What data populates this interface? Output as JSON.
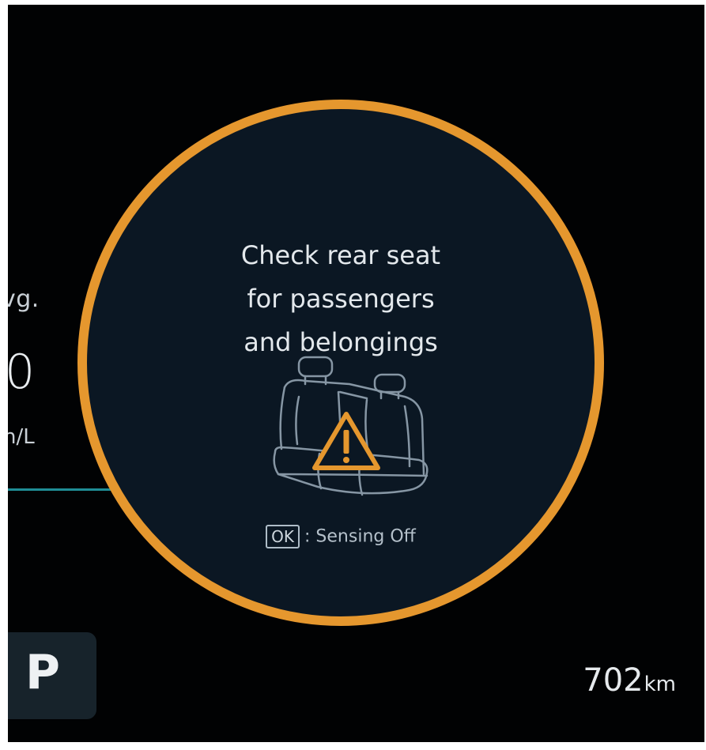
{
  "fuel_economy": {
    "label_partial": "vg.",
    "value_partial": "0",
    "unit_partial": "n/L"
  },
  "gear": {
    "current": "P"
  },
  "range": {
    "value": "702",
    "unit": "km"
  },
  "warning": {
    "message_lines": [
      "Check rear seat",
      "for passengers",
      "and belongings"
    ],
    "icon": "rear-seat-warning-icon",
    "ok_key_label": "OK",
    "ok_action_text": ": Sensing Off",
    "colors": {
      "ring": "#e5972e",
      "alert_triangle": "#e5972e",
      "background": "#0b1723"
    }
  }
}
